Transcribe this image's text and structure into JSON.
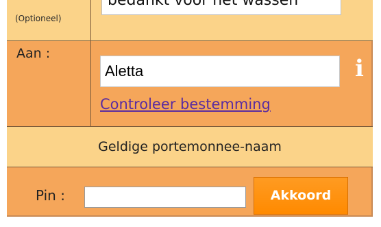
{
  "message_row": {
    "optional_label": "(Optioneel)",
    "message_value": "bedankt voor het wassen"
  },
  "recipient_row": {
    "label": "Aan :",
    "value": "Aletta",
    "info_icon": "info-icon",
    "check_link": "Controleer bestemming"
  },
  "status": {
    "text": "Geldige portemonnee-naam"
  },
  "pin_row": {
    "label": "Pin :",
    "value": "",
    "button_label": "Akkoord"
  },
  "colors": {
    "form_bg": "#f5a65a",
    "light_bg": "#fbd389",
    "button_bg": "#ff8a00",
    "link": "#5a2ca0"
  }
}
